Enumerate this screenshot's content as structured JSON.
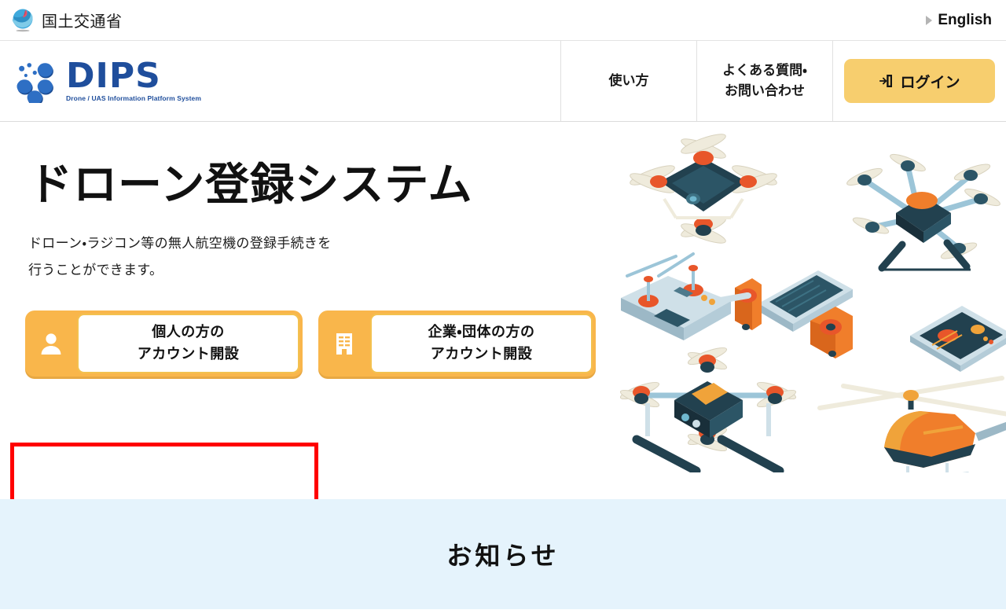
{
  "topbar": {
    "ministry_name": "国土交通省",
    "ministry_logo_icon": "mlit-swirl-logo",
    "english_link": "English",
    "english_marker_icon": "triangle-right-icon"
  },
  "header": {
    "logo": {
      "wordmark": "DIPS",
      "tagline": "Drone / UAS Information Platform System",
      "dots_icon": "dips-dots-logo"
    },
    "nav_items": [
      {
        "label": "使い方"
      },
      {
        "label_line1": "よくある質問・",
        "label_line2": "お問い合わせ"
      }
    ],
    "login_button": {
      "label": "ログイン",
      "icon": "login-door-icon",
      "color": "#F7CE6E"
    }
  },
  "hero": {
    "title": "ドローン登録システム",
    "description_line1": "ドローン・ラジコン等の無人航空機の登録手続きを",
    "description_line2": "行うことができます。",
    "cta_buttons": [
      {
        "icon": "person-icon",
        "line1": "個人の方の",
        "line2": "アカウント開設",
        "color": "#F9B64B",
        "highlighted": true
      },
      {
        "icon": "building-icon",
        "line1": "企業・団体の方の",
        "line2": "アカウント開設",
        "color": "#F9B64B",
        "highlighted": false
      }
    ],
    "annotation": {
      "shape": "rectangle",
      "color": "#FF0000",
      "target": "個人の方のアカウント開設"
    },
    "illustration_icon": "isometric-drones-illustration"
  },
  "notice": {
    "title": "お知らせ",
    "background_color": "#E5F3FC"
  }
}
